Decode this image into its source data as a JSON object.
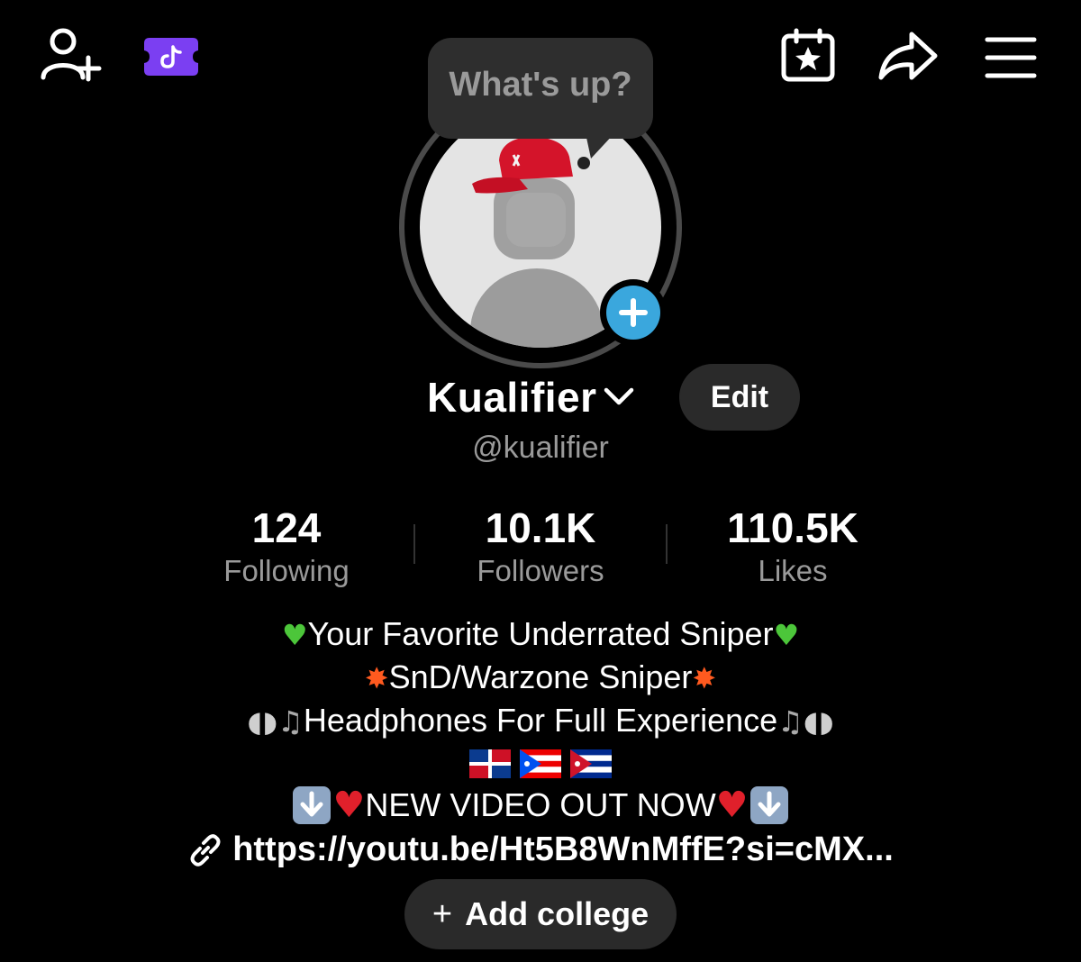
{
  "bubble": {
    "text": "What's up?"
  },
  "profile": {
    "username": "Kualifier",
    "handle": "@kualifier",
    "edit_label": "Edit"
  },
  "stats": [
    {
      "value": "124",
      "label": "Following"
    },
    {
      "value": "10.1K",
      "label": "Followers"
    },
    {
      "value": "110.5K",
      "label": "Likes"
    }
  ],
  "bio": {
    "line1": "Your Favorite Underrated Sniper",
    "line2": "SnD/Warzone Sniper",
    "line3": "Headphones For Full Experience",
    "line5": "NEW VIDEO OUT NOW",
    "link": "https://youtu.be/Ht5B8WnMffE?si=cMX..."
  },
  "college": {
    "label": "Add college",
    "plus": "+"
  },
  "icons": {
    "add_friend": "add-friend-icon",
    "ticket": "tiktok-ticket-icon",
    "calendar": "calendar-star-icon",
    "share": "share-arrow-icon",
    "menu": "hamburger-menu-icon",
    "link": "link-icon"
  },
  "colors": {
    "background": "#000000",
    "accent_blue": "#3aa7dd",
    "ticket_purple": "#7b3ff2",
    "muted_text": "#9a9a9a",
    "button_bg": "#2a2a2a"
  }
}
